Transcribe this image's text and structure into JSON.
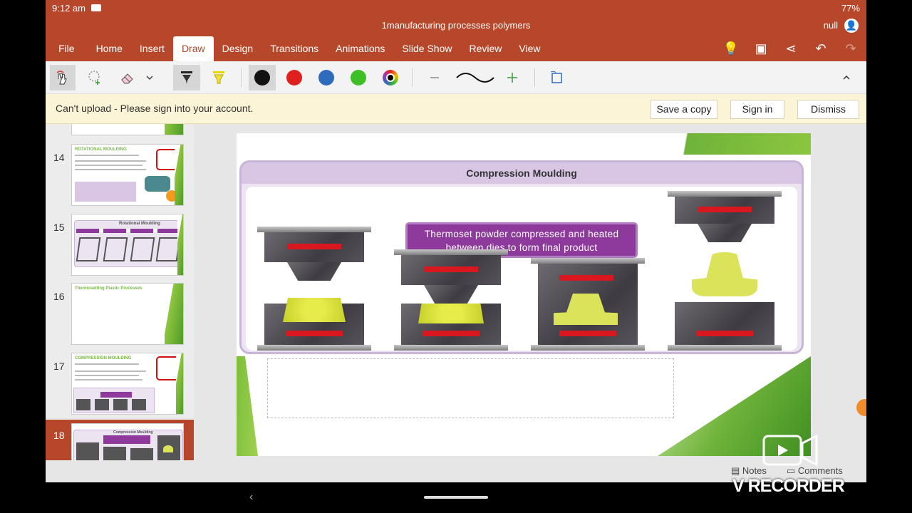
{
  "status": {
    "time": "9:12 am",
    "right": "77%"
  },
  "app": {
    "doc_title": "1manufacturing processes polymers",
    "user": "null"
  },
  "menu": {
    "tabs": [
      "File",
      "Home",
      "Insert",
      "Draw",
      "Design",
      "Transitions",
      "Animations",
      "Slide Show",
      "Review",
      "View"
    ],
    "active": "Draw"
  },
  "ribbon": {
    "pen_colors": [
      "#111111",
      "#e0201e",
      "#2e6bbd",
      "#3fbf26"
    ]
  },
  "message": {
    "text": "Can't upload - Please sign into your account.",
    "save_copy": "Save a copy",
    "sign_in": "Sign in",
    "dismiss": "Dismiss"
  },
  "thumbnails": {
    "s14": {
      "num": "14",
      "title": "ROTATIONAL MOULDING"
    },
    "s15": {
      "num": "15",
      "title": "Rotational Moulding"
    },
    "s16": {
      "num": "16",
      "title": "Thermosetting Plastic Processes"
    },
    "s17": {
      "num": "17",
      "title": "COMPRESSION MOULDING"
    },
    "s18": {
      "num": "18",
      "title": "Compression Moulding"
    }
  },
  "slide": {
    "title": "Compression Moulding",
    "caption_line1": "Thermoset powder compressed and heated",
    "caption_line2": "between dies to form final product"
  },
  "bottom": {
    "notes": "Notes",
    "comments": "Comments"
  },
  "watermark": "V RECORDER"
}
